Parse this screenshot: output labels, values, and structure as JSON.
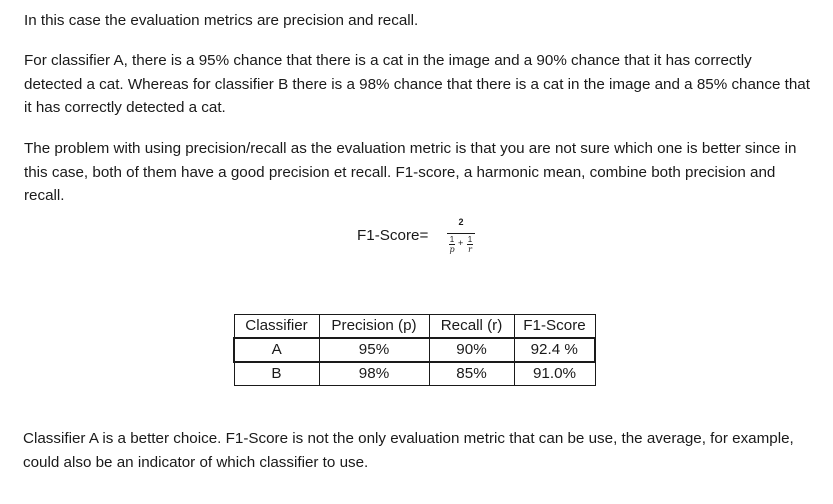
{
  "paragraphs": {
    "intro": "In this case the evaluation metrics are precision and recall.",
    "classifiers": "For classifier A, there is a 95% chance that there is a cat in the image and a 90% chance that it has correctly detected a cat. Whereas for classifier B there is a 98% chance that there is a cat in the image and a 85% chance that it has correctly detected a cat.",
    "problem": "The problem with using precision/recall as the evaluation metric is that you are not sure which one is better since in this case, both of them have a good precision et recall. F1-score, a harmonic mean, combine both precision and recall.",
    "conclusion": "Classifier A is a better choice. F1-Score is not the only evaluation metric that can be use, the average, for example, could also be an indicator of which classifier to use."
  },
  "formula": {
    "label": "F1-Score=",
    "numerator": "2",
    "term1_num": "1",
    "term1_den": "p",
    "plus": "+",
    "term2_num": "1",
    "term2_den": "r"
  },
  "table": {
    "headers": [
      "Classifier",
      "Precision (p)",
      "Recall (r)",
      "F1-Score"
    ],
    "rows": [
      [
        "A",
        "95%",
        "90%",
        "92.4 %"
      ],
      [
        "B",
        "98%",
        "85%",
        "91.0%"
      ]
    ]
  }
}
